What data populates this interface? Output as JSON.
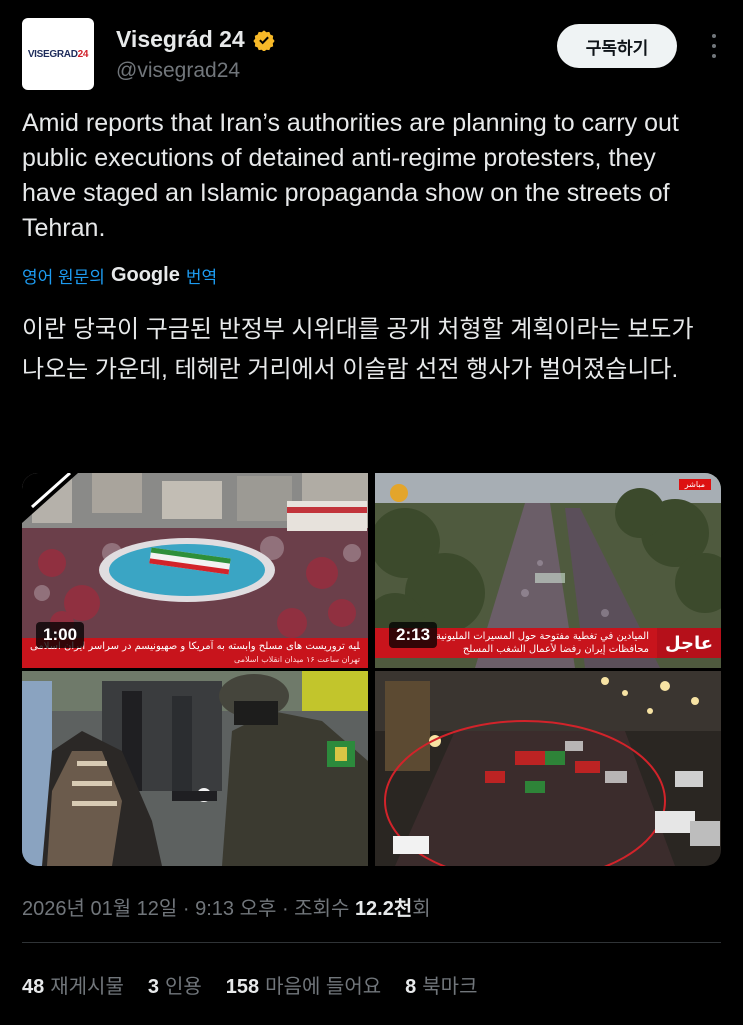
{
  "account": {
    "display_name": "Visegrád 24",
    "handle": "@visegrad24",
    "avatar_text_a": "VISEGRAD",
    "avatar_text_b": "24"
  },
  "header": {
    "subscribe_label": "구독하기"
  },
  "tweet": {
    "text": "Amid reports that Iran’s authorities are planning to carry out public executions of detained anti-regime protesters, they have staged an Islamic propaganda show on the streets of Tehran.",
    "translate_prefix": "영어 원문의",
    "translate_brand": "Google",
    "translate_suffix": "번역",
    "translated_text": "이란 당국이 구금된 반정부 시위대를 공개 처형할 계획이라는 보도가 나오는 가운데, 테헤란 거리에서 이슬람 선전 행사가 벌어졌습니다."
  },
  "media": {
    "video1_duration": "1:00",
    "video1_ticker": "خروش عظیم ملت علیه تروریست های مسلح وابسته به آمریکا و صهیونیسم در سراسر ایران اسلامی",
    "video1_ticker_sub": "تهران  ساعت ۱۶  میدان انقلاب اسلامی",
    "video2_duration": "2:13",
    "video2_live": "مباشر",
    "video2_tag": "عاجل",
    "video2_ticker": "الميادين في تغطية مفتوحة حول المسيرات المليونية",
    "video2_ticker_sub": "محافظات إيران رفضا لأعمال الشغب المسلح"
  },
  "meta": {
    "date": "2026년 01월 12일",
    "time": "9:13 오후",
    "views_prefix": "조회수",
    "views_value": "12.2천",
    "views_suffix": "회"
  },
  "stats": [
    {
      "count": "48",
      "label": "재게시물"
    },
    {
      "count": "3",
      "label": "인용"
    },
    {
      "count": "158",
      "label": "마음에 들어요"
    },
    {
      "count": "8",
      "label": "북마크"
    }
  ],
  "colors": {
    "accent": "#1d9bf0",
    "verified": "#f7b928",
    "background": "#000000"
  }
}
